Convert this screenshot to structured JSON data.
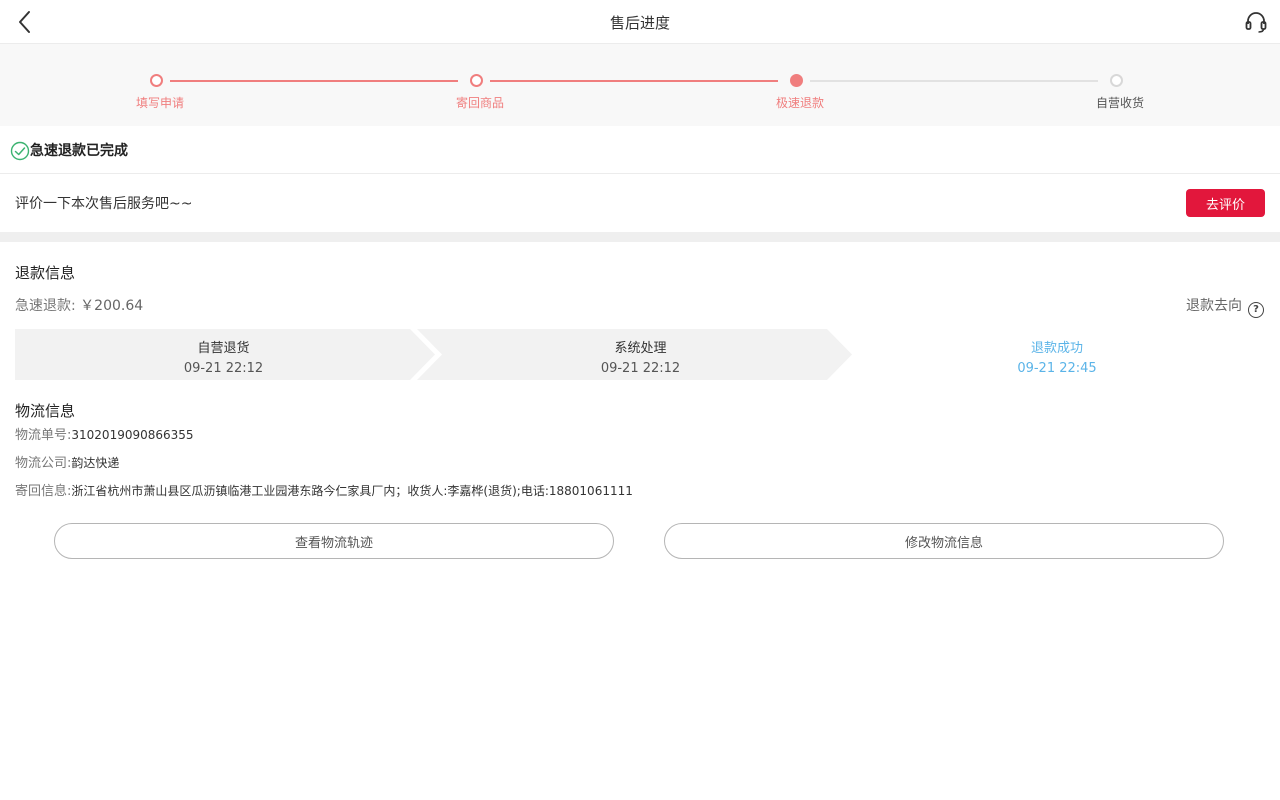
{
  "header": {
    "title": "售后进度",
    "back_icon": "chevron-left-icon",
    "service_icon": "headset-icon"
  },
  "progress": {
    "steps": [
      {
        "label": "填写申请",
        "state": "done"
      },
      {
        "label": "寄回商品",
        "state": "done"
      },
      {
        "label": "极速退款",
        "state": "current"
      },
      {
        "label": "自营收货",
        "state": "todo"
      }
    ]
  },
  "status": {
    "icon": "check-circle-icon",
    "text": "急速退款已完成"
  },
  "review": {
    "prompt": "评价一下本次售后服务吧~~",
    "button_label": "去评价"
  },
  "refund": {
    "section_title": "退款信息",
    "amount_label": "急速退款:",
    "amount_value": "￥200.64",
    "destination_label": "退款去向",
    "help_icon": "question-circle-icon",
    "flow": [
      {
        "title": "自营退货",
        "time": "09-21 22:12",
        "active": false
      },
      {
        "title": "系统处理",
        "time": "09-21 22:12",
        "active": false
      },
      {
        "title": "退款成功",
        "time": "09-21 22:45",
        "active": true
      }
    ]
  },
  "logistics": {
    "section_title": "物流信息",
    "tracking_label": "物流单号:",
    "tracking_value": "3102019090866355",
    "company_label": "物流公司:",
    "company_value": "韵达快递",
    "return_label": "寄回信息:",
    "return_value": "浙江省杭州市萧山县区瓜沥镇临港工业园港东路今仁家具厂内；收货人:李嘉桦(退货);电话:18801061111"
  },
  "actions": {
    "track_label": "查看物流轨迹",
    "modify_label": "修改物流信息"
  },
  "colors": {
    "accent_red": "#e2173c",
    "progress_pink": "#f07e7e",
    "success_green": "#3cb371",
    "flow_active_bg": "#d4ebfb",
    "flow_active_text": "#5bb4e8"
  }
}
